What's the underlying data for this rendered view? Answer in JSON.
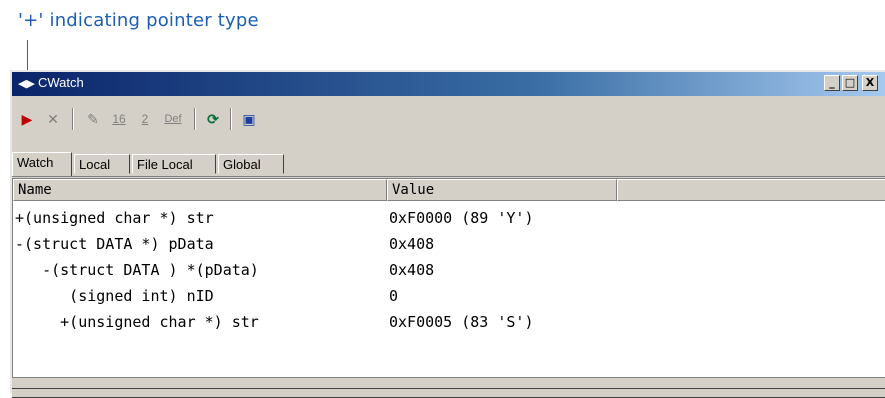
{
  "annotation": {
    "text": "'+' indicating pointer type"
  },
  "window": {
    "title": "CWatch",
    "controls": {
      "minimize": "_",
      "restore": "□",
      "close": "X"
    }
  },
  "toolbar": {
    "items": [
      {
        "name": "watch-add-icon",
        "glyph": "▶"
      },
      {
        "name": "delete-icon",
        "glyph": "✕"
      },
      {
        "name": "edit-icon",
        "glyph": "✎"
      },
      {
        "name": "radix-16-icon",
        "glyph": "16"
      },
      {
        "name": "radix-2-icon",
        "glyph": "2"
      },
      {
        "name": "radix-default-icon",
        "glyph": "Def"
      },
      {
        "name": "refresh-icon",
        "glyph": "⟳"
      },
      {
        "name": "window-icon",
        "glyph": "▣"
      }
    ]
  },
  "tabs": [
    "Watch",
    "Local",
    "File Local",
    "Global"
  ],
  "columns": {
    "name": "Name",
    "value": "Value"
  },
  "rows": [
    {
      "name": "+(unsigned char *) str",
      "value": "0xF0000 (89 'Y')"
    },
    {
      "name": "-(struct DATA *) pData",
      "value": "0x408"
    },
    {
      "name": "   -(struct DATA ) *(pData)",
      "value": "0x408"
    },
    {
      "name": "      (signed int) nID",
      "value": "0"
    },
    {
      "name": "     +(unsigned char *) str",
      "value": "0xF0005 (83 'S')"
    }
  ],
  "colors": {
    "annotation": "#1a5fb4",
    "titlebar_start": "#0a246a",
    "titlebar_end": "#a6caf0"
  }
}
